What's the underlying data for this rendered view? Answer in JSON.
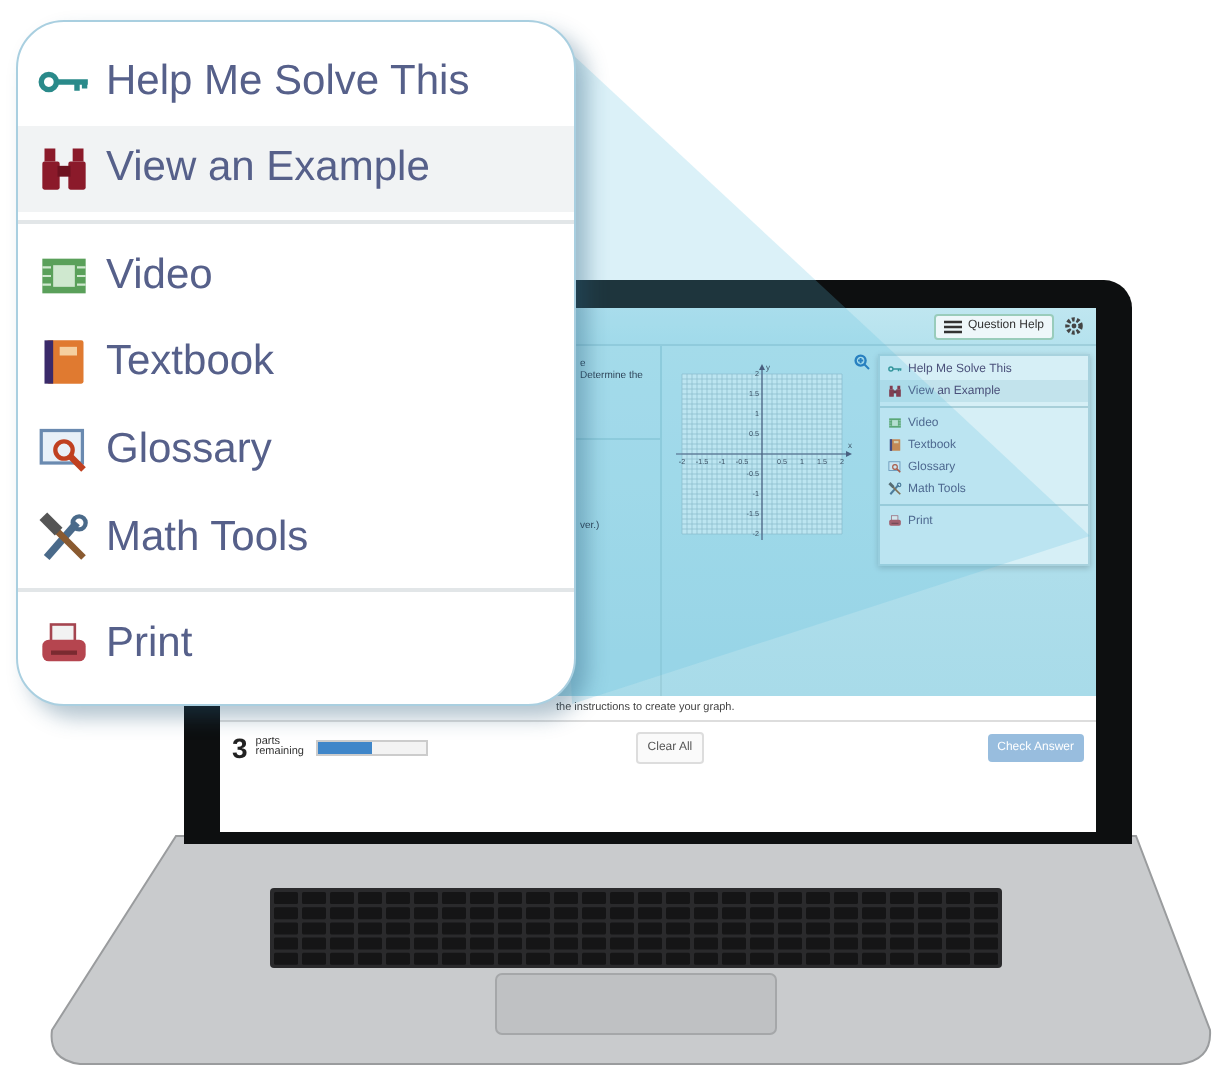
{
  "callout": {
    "groups": [
      [
        {
          "label": "Help Me Solve This",
          "selected": false
        },
        {
          "label": "View an Example",
          "selected": true
        }
      ],
      [
        {
          "label": "Video",
          "selected": false
        },
        {
          "label": "Textbook",
          "selected": false
        },
        {
          "label": "Glossary",
          "selected": false
        },
        {
          "label": "Math Tools",
          "selected": false
        }
      ],
      [
        {
          "label": "Print",
          "selected": false
        }
      ]
    ]
  },
  "screen": {
    "toolbar": {
      "help_button": "Question Help"
    },
    "question_fragments": [
      "e",
      "Determine the",
      "ver.)"
    ],
    "graph": {
      "x_label": "x",
      "y_label": "y",
      "x_ticks": [
        "-2",
        "-1.5",
        "-1",
        "-0.5",
        "0.5",
        "1",
        "1.5",
        "2"
      ],
      "y_ticks": [
        "2",
        "1.5",
        "1",
        "0.5",
        "-0.5",
        "-1",
        "-1.5",
        "-2"
      ]
    },
    "help_menu": {
      "groups": [
        [
          {
            "label": "Help Me Solve This",
            "selected": false
          },
          {
            "label": "View an Example",
            "selected": true
          }
        ],
        [
          {
            "label": "Video",
            "selected": false
          },
          {
            "label": "Textbook",
            "selected": false
          },
          {
            "label": "Glossary",
            "selected": false
          },
          {
            "label": "Math Tools",
            "selected": false
          }
        ],
        [
          {
            "label": "Print",
            "selected": false
          }
        ]
      ]
    },
    "instruction": "the instructions to create your graph.",
    "parts": {
      "count": "3",
      "label": "parts remaining",
      "level": 0.5
    },
    "buttons": [
      {
        "label": "Clear All",
        "kind": "secondary",
        "disabled": false
      },
      {
        "label": "Check Answer",
        "kind": "primary",
        "disabled": true
      }
    ]
  }
}
